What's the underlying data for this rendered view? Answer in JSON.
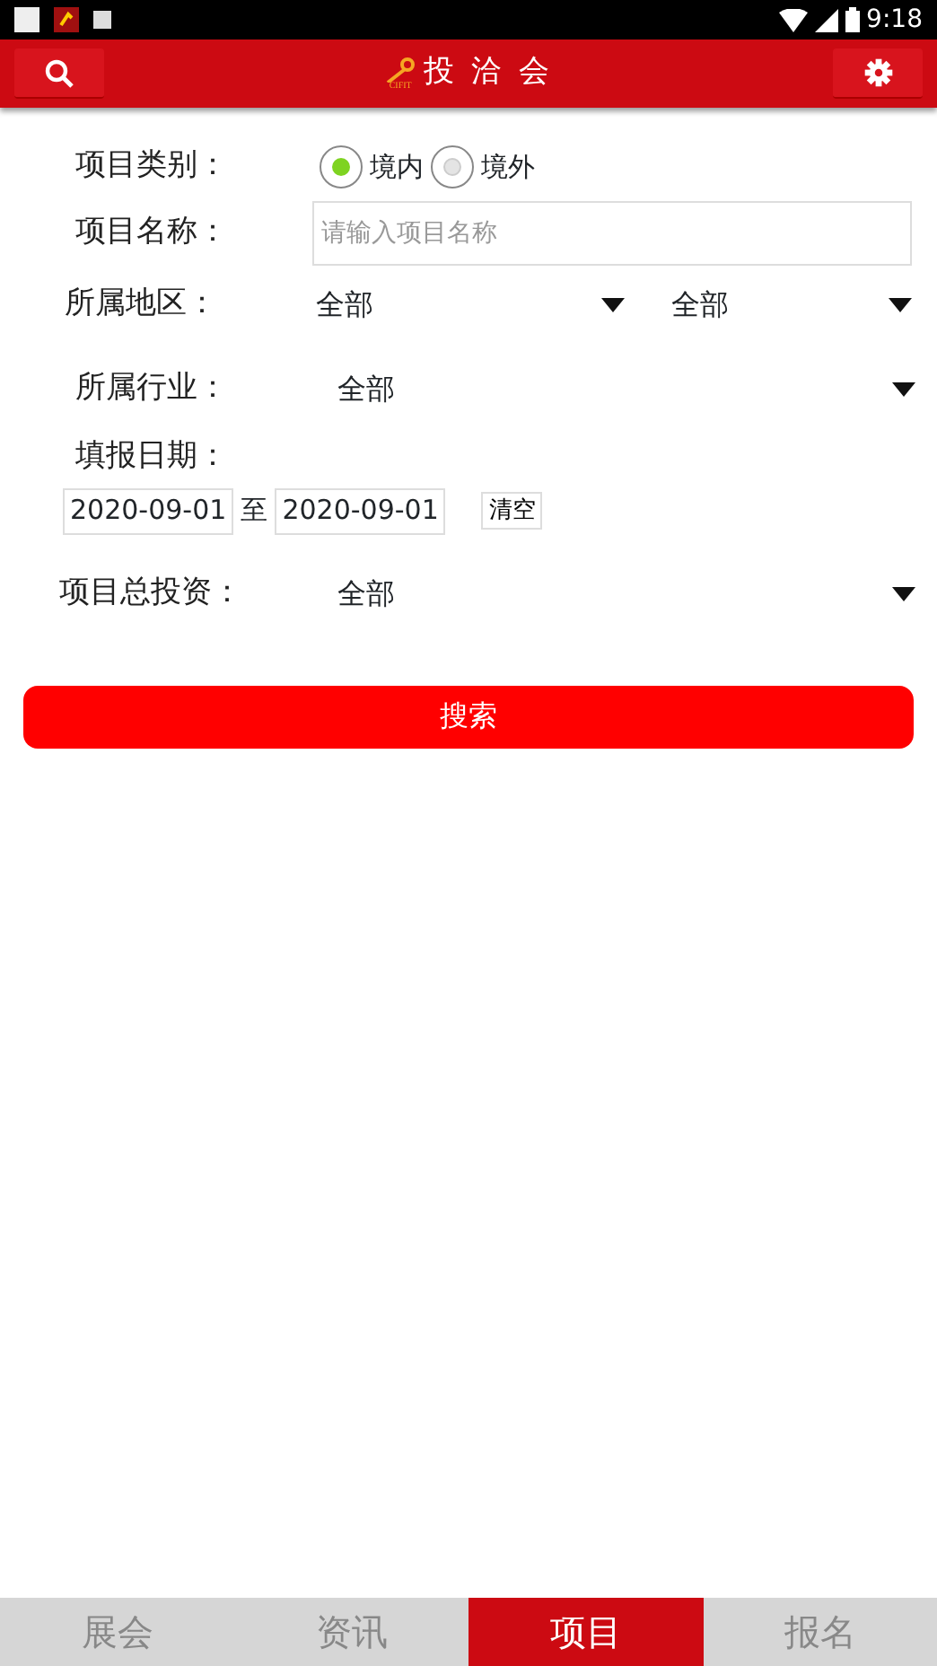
{
  "status_bar": {
    "time": "9:18"
  },
  "header": {
    "logo_text": "CIFIT",
    "title": "投 洽 会"
  },
  "form": {
    "category": {
      "label": "项目类别：",
      "options": [
        {
          "label": "境内",
          "selected": true
        },
        {
          "label": "境外",
          "selected": false
        }
      ]
    },
    "name": {
      "label": "项目名称：",
      "placeholder": "请输入项目名称"
    },
    "region": {
      "label": "所属地区：",
      "values": [
        "全部",
        "全部"
      ]
    },
    "industry": {
      "label": "所属行业：",
      "value": "全部"
    },
    "date": {
      "label": "填报日期：",
      "from": "2020-09-01",
      "separator": "至",
      "to": "2020-09-01",
      "clear": "清空"
    },
    "investment": {
      "label": "项目总投资：",
      "value": "全部"
    },
    "search_button": "搜索"
  },
  "tabs": [
    {
      "label": "展会",
      "selected": false
    },
    {
      "label": "资讯",
      "selected": false
    },
    {
      "label": "项目",
      "selected": true
    },
    {
      "label": "报名",
      "selected": false
    }
  ]
}
